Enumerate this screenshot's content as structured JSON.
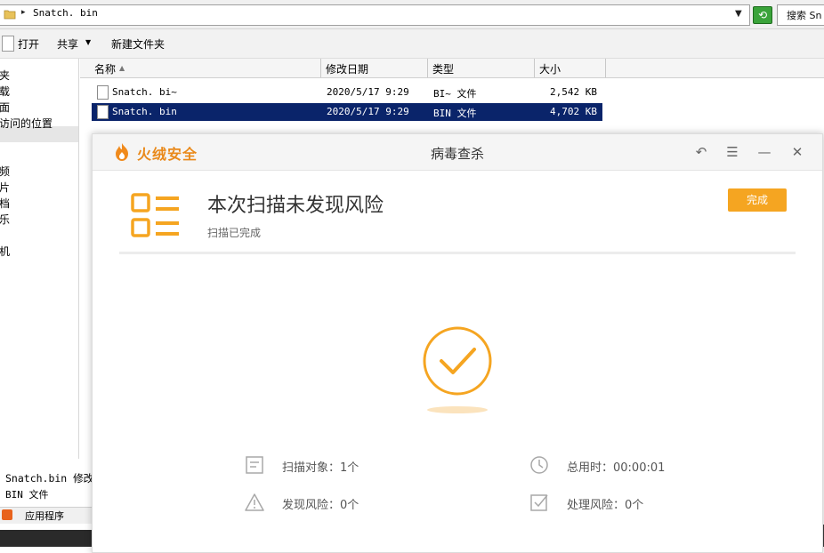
{
  "explorer": {
    "address_path": "Snatch. bin",
    "search_label": "搜索 Sn",
    "toolbar": {
      "open_label": "打开",
      "share_label": "共享",
      "new_folder_label": "新建文件夹"
    },
    "nav_items": [
      "夹",
      "载",
      "面",
      "访问的位置",
      "频",
      "片",
      "档",
      "乐",
      "机"
    ],
    "columns": {
      "name": "名称",
      "date": "修改日期",
      "type": "类型",
      "size": "大小"
    },
    "files": [
      {
        "name": "Snatch. bi~",
        "date": "2020/5/17 9:29",
        "type": "BI~ 文件",
        "size": "2,542 KB"
      },
      {
        "name": "Snatch. bin",
        "date": "2020/5/17 9:29",
        "type": "BIN 文件",
        "size": "4,702 KB"
      }
    ],
    "details": {
      "name_line": "Snatch.bin 修改",
      "type_line": "BIN 文件"
    },
    "taskbar_label": "应用程序"
  },
  "dialog": {
    "brand": "火绒安全",
    "title": "病毒查杀",
    "result_title": "本次扫描未发现风险",
    "result_subtitle": "扫描已完成",
    "done_button": "完成",
    "stats": {
      "scan_objects": "扫描对象：1个",
      "total_time": "总用时：00:00:01",
      "risks_found": "发现风险：0个",
      "risks_handled": "处理风险：0个"
    },
    "colors": {
      "accent": "#f5a521",
      "brand": "#e9891a"
    }
  }
}
